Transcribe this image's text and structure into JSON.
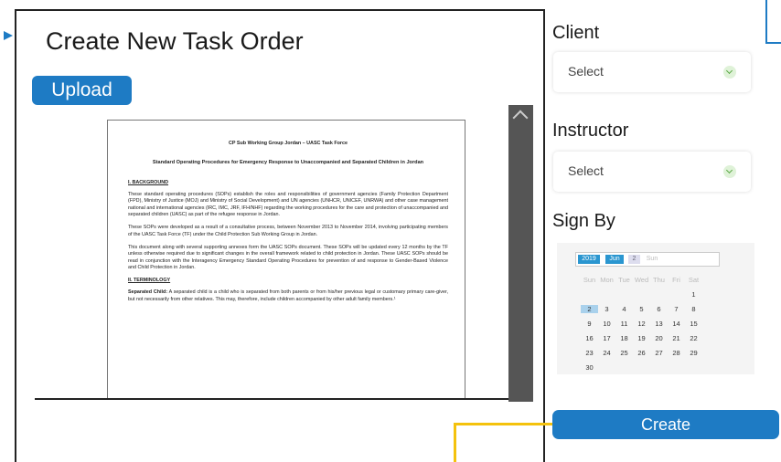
{
  "page": {
    "title": "Create New Task Order",
    "upload_label": "Upload",
    "create_label": "Create"
  },
  "document": {
    "header": "CP Sub Working Group Jordan – UASC Task Force",
    "subtitle": "Standard Operating Procedures for Emergency Response to Unaccompanied and Separated Children in Jordan",
    "section1": "I. BACKGROUND",
    "p1": "These standard operating procedures (SOPs) establish the roles and responsibilities of government agencies (Family Protection Department (FPD), Ministry of Justice (MOJ) and Ministry of Social Development) and UN agencies (UNHCR, UNICEF, UNRWA) and other case management national and international agencies (IRC, IMC, JRF, IFH/NHF) regarding the working procedures for the care and protection of unaccompanied and separated children (UASC) as part of the refugee response in Jordan.",
    "p2": "These SOPs were developed as a result of a consultative process, between November 2013 to November 2014, involving participating members of the UASC Task Force (TF) under the Child Protection Sub Working Group in Jordan.",
    "p3": "This document along with several supporting annexes form the UASC SOPs document. These SOPs will be updated every 12 months by the TF unless otherwise required due to significant changes in the overall framework related to child protection in Jordan. These UASC SOPs should be read in conjunction with the Interagency Emergency Standard Operating Procedures for prevention of and response to Gender-Based Violence and Child Protection in Jordan.",
    "section2": "II. TERMINOLOGY",
    "p4_term": "Separated Child:",
    "p4": " A separated child is a child who is separated from both parents or from his/her previous legal or customary primary care-giver, but not necessarily from other relatives. This may, therefore, include children accompanied by other adult family members.¹"
  },
  "client": {
    "label": "Client",
    "value": "Select"
  },
  "instructor": {
    "label": "Instructor",
    "value": "Select"
  },
  "sign_by": {
    "label": "Sign By",
    "calendar": {
      "year": "2019",
      "month": "Jun",
      "day": "2",
      "weekday": "Sun",
      "weekday_headers": [
        "Sun",
        "Mon",
        "Tue",
        "Wed",
        "Thu",
        "Fri",
        "Sat"
      ],
      "weeks": [
        [
          "",
          "",
          "",
          "",
          "",
          "",
          "1"
        ],
        [
          "2",
          "3",
          "4",
          "5",
          "6",
          "7",
          "8"
        ],
        [
          "9",
          "10",
          "11",
          "12",
          "13",
          "14",
          "15"
        ],
        [
          "16",
          "17",
          "18",
          "19",
          "20",
          "21",
          "22"
        ],
        [
          "23",
          "24",
          "25",
          "26",
          "27",
          "28",
          "29"
        ],
        [
          "30",
          "",
          "",
          "",
          "",
          "",
          ""
        ]
      ],
      "selected": "2"
    }
  },
  "colors": {
    "accent": "#1e7bc4",
    "connector": "#f4c20d",
    "scrollbar": "#555555"
  }
}
